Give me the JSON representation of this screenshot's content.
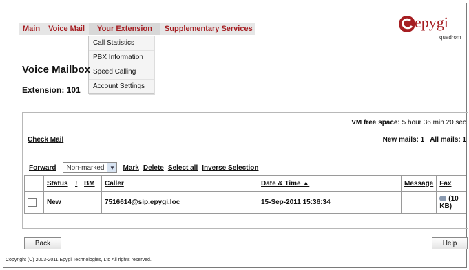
{
  "nav": {
    "items": [
      {
        "label": "Main"
      },
      {
        "label": "Voice Mail"
      },
      {
        "label": "Your Extension"
      },
      {
        "label": "Supplementary Services"
      }
    ],
    "dropdown": [
      "Call Statistics",
      "PBX Information",
      "Speed Calling",
      "Account Settings"
    ]
  },
  "logo": {
    "word": "epygi",
    "sub": "quadrom"
  },
  "page": {
    "title": "Voice Mailbox",
    "extension": "Extension: 101"
  },
  "status": {
    "vm_free_label": "VM free space:",
    "vm_free_value": "5 hour 36 min 20 sec",
    "new_mails": "New mails:  1",
    "all_mails": "All mails:  1"
  },
  "check_mail": "Check Mail",
  "actions": {
    "forward": "Forward",
    "filter_value": "Non-marked",
    "mark": "Mark",
    "delete": "Delete",
    "select_all": "Select all",
    "inverse": "Inverse Selection"
  },
  "table": {
    "headers": [
      "Status",
      "!",
      "BM",
      "Caller",
      "Date & Time ▲",
      "Message",
      "Fax"
    ],
    "rows": [
      {
        "status": "New",
        "important": "",
        "bm": "",
        "caller": "7516614@sip.epygi.loc",
        "datetime": "15-Sep-2011 15:36:34",
        "message": "",
        "fax": "(10 KB)"
      }
    ]
  },
  "buttons": {
    "back": "Back",
    "help": "Help"
  },
  "copyright": {
    "prefix": "Copyright (C) 2003-2011 ",
    "company": "Epygi Technologies, Ltd",
    "suffix": "  All rights reserved."
  },
  "colors": {
    "brand": "#a61e22"
  }
}
